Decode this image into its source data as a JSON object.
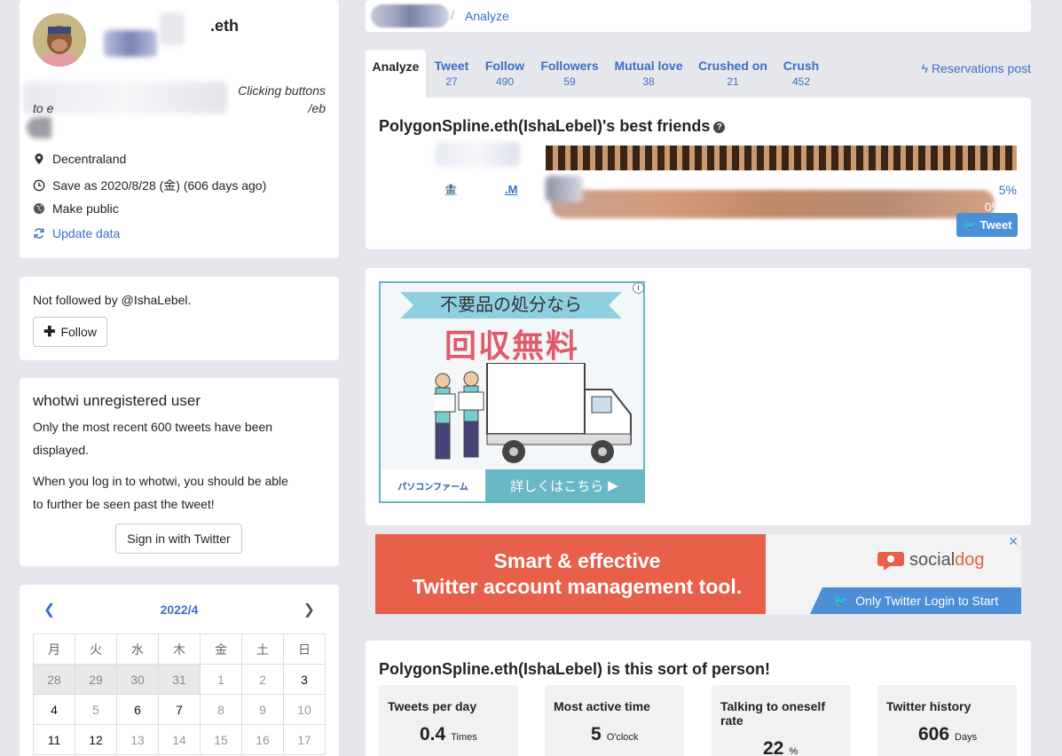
{
  "profile": {
    "name_suffix": ".eth",
    "bio_line1": "Clicking buttons",
    "bio_line2_start": "to e",
    "bio_line2_end": "/eb",
    "location": "Decentraland",
    "saved": "Save as 2020/8/28 (金) (606 days ago)",
    "visibility": "Make public",
    "update_link": "Update data"
  },
  "follow_card": {
    "status": "Not followed by @IshaLebel.",
    "follow_label": "Follow"
  },
  "unregistered": {
    "title": "whotwi unregistered user",
    "para1": "Only the most recent 600 tweets have been displayed.",
    "para2": "When you log in to whotwi, you should be able to further be seen past the tweet!",
    "signin_label": "Sign in with Twitter"
  },
  "calendar": {
    "month": "2022/4",
    "weekdays": [
      "月",
      "火",
      "水",
      "木",
      "金",
      "土",
      "日"
    ],
    "rows": [
      [
        "28",
        "29",
        "30",
        "31",
        "1",
        "2",
        "3"
      ],
      [
        "4",
        "5",
        "6",
        "7",
        "8",
        "9",
        "10"
      ],
      [
        "11",
        "12",
        "13",
        "14",
        "15",
        "16",
        "17"
      ]
    ]
  },
  "breadcrumb": {
    "current": "Analyze"
  },
  "tabs": [
    {
      "label": "Analyze",
      "count": ""
    },
    {
      "label": "Tweet",
      "count": "27"
    },
    {
      "label": "Follow",
      "count": "490"
    },
    {
      "label": "Followers",
      "count": "59"
    },
    {
      "label": "Mutual love",
      "count": "38"
    },
    {
      "label": "Crushed on",
      "count": "21"
    },
    {
      "label": "Crush",
      "count": "452"
    }
  ],
  "reservations": "Reservations post",
  "best_friends": {
    "title": "PolygonSpline.eth(IshaLebel)'s best friends",
    "bar1_pct": "0%",
    "friend2_prefix": "🏦",
    "friend2_name": ".M",
    "friend2_pct": "5%",
    "tweet_label": "Tweet"
  },
  "ad1": {
    "ribbon": "不要品の処分なら",
    "headline": "回収無料",
    "logo_text": "パソコンファーム",
    "cta": "詳しくはこちら"
  },
  "ad2": {
    "line1": "Smart & effective",
    "line2": "Twitter account management tool.",
    "brand_prefix": "social",
    "brand_suffix": "dog",
    "cta": "Only Twitter Login to Start",
    "close": "✕"
  },
  "person": {
    "title": "PolygonSpline.eth(IshaLebel) is this sort of person!",
    "stats": [
      {
        "title": "Tweets per day",
        "value": "0.4",
        "unit": "Times"
      },
      {
        "title": "Most active time",
        "value": "5",
        "unit": "O'clock"
      },
      {
        "title": "Talking to oneself rate",
        "value": "22",
        "unit": "%"
      },
      {
        "title": "Twitter history",
        "value": "606",
        "unit": "Days"
      }
    ]
  },
  "colors": {
    "link": "#3b6fc4",
    "tweet_button": "#4a90d9",
    "ad_orange": "#e8604a"
  }
}
